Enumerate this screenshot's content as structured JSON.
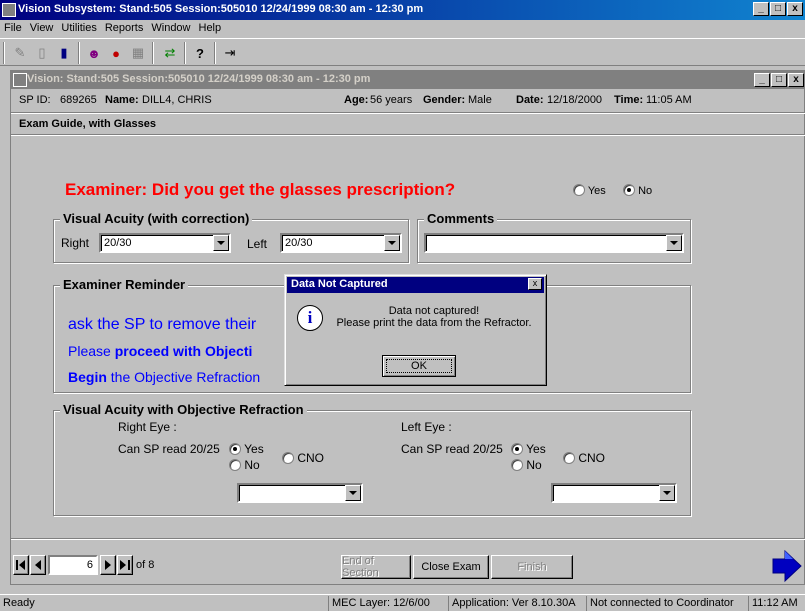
{
  "app": {
    "title": "Vision Subsystem: Stand:505 Session:505010 12/24/1999 08:30 am - 12:30 pm",
    "buttons": [
      "_",
      "□",
      "x"
    ]
  },
  "menu": {
    "items": [
      "File",
      "View",
      "Utilities",
      "Reports",
      "Window",
      "Help"
    ]
  },
  "toolbar": {
    "icons": [
      "new-icon",
      "delete-icon",
      "export-icon",
      "people-icon",
      "record-icon",
      "calendar-icon",
      "transfer-icon",
      "help-icon",
      "exit-icon"
    ]
  },
  "inner": {
    "title": "Vision: Stand:505 Session:505010 12/24/1999 08:30 am - 12:30 pm",
    "sp_id_label": "SP ID:",
    "sp_id": "689265",
    "name_label": "Name:",
    "name": "DILL4, CHRIS",
    "age_label": "Age:",
    "age": "56 years",
    "gender_label": "Gender:",
    "gender": "Male",
    "date_label": "Date:",
    "date": "12/18/2000",
    "time_label": "Time:",
    "time": "11:05 AM",
    "section_title": "Exam Guide, with Glasses"
  },
  "question": {
    "text": "Examiner: Did you get the glasses prescription?",
    "yes": "Yes",
    "no": "No",
    "selected": "No",
    "color": "#ff0000"
  },
  "visual_acuity": {
    "legend": "Visual Acuity (with correction)",
    "right_label": "Right",
    "right_value": "20/30",
    "left_label": "Left",
    "left_value": "20/30"
  },
  "comments": {
    "legend": "Comments",
    "value": ""
  },
  "reminder": {
    "legend": "Examiner Reminder",
    "line1": "ask the SP to remove their",
    "line2_a": "Please",
    "line2_b": "proceed with Objecti",
    "line3_a": "Begin",
    "line3_b": "the Objective Refraction",
    "color": "#0000ff"
  },
  "objective": {
    "legend": "Visual Acuity with Objective Refraction",
    "right_eye": "Right Eye :",
    "left_eye": "Left Eye :",
    "can_read": "Can SP read 20/25",
    "yes": "Yes",
    "no": "No",
    "cno": "CNO",
    "right_selected": "Yes",
    "left_selected": "Yes"
  },
  "nav": {
    "page": "6",
    "of": "of 8",
    "end_of_section": "End of Section",
    "close_exam": "Close Exam",
    "finish": "Finish"
  },
  "dialog": {
    "title": "Data Not Captured",
    "line1": "Data not captured!",
    "line2": "Please print the data from the Refractor.",
    "ok": "OK"
  },
  "status": {
    "ready": "Ready",
    "mec_layer": "MEC Layer: 12/6/00",
    "application": "Application: Ver 8.10.30A",
    "connection": "Not connected to Coordinator",
    "clock": "11:12 AM"
  }
}
